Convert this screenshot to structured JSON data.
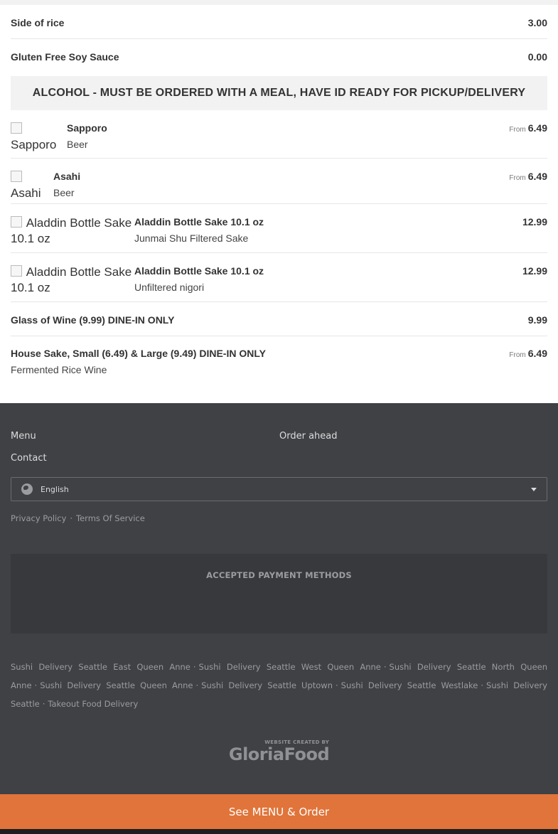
{
  "menu_items_top": [
    {
      "name": "Side of rice",
      "price": "3.00"
    },
    {
      "name": "Gluten Free Soy Sauce",
      "price": "0.00"
    }
  ],
  "category": {
    "title": "ALCOHOL - MUST BE ORDERED WITH A MEAL, HAVE ID READY FOR PICKUP/DELIVERY"
  },
  "items": [
    {
      "img_alt": "Sapporo",
      "name": "Sapporo",
      "desc": "Beer",
      "from": "From",
      "price": "6.49"
    },
    {
      "img_alt": "Asahi",
      "name": "Asahi",
      "desc": "Beer",
      "from": "From",
      "price": "6.49"
    },
    {
      "img_alt_1": "Aladdin Bottle Sake",
      "img_alt_2": "10.1 oz",
      "name": "Aladdin Bottle Sake 10.1 oz",
      "desc": "Junmai Shu Filtered Sake",
      "price": "12.99"
    },
    {
      "img_alt_1": "Aladdin Bottle Sake",
      "img_alt_2": "10.1 oz",
      "name": "Aladdin Bottle Sake 10.1 oz",
      "desc": "Unfiltered nigori",
      "price": "12.99"
    }
  ],
  "wine": {
    "name": "Glass of Wine (9.99) DINE-IN ONLY",
    "price": "9.99"
  },
  "house_sake": {
    "name": "House Sake, Small (6.49) & Large (9.49) DINE-IN ONLY",
    "desc": "Fermented Rice Wine",
    "from": "From",
    "price": "6.49"
  },
  "footer": {
    "links": {
      "menu": "Menu",
      "order_ahead": "Order ahead",
      "contact": "Contact"
    },
    "language": "English",
    "legal": {
      "privacy": "Privacy Policy",
      "terms": "Terms Of Service",
      "sep": "·"
    },
    "payment_title": "ACCEPTED PAYMENT METHODS",
    "delivery_links": [
      "Sushi Delivery Seattle East Queen Anne",
      "Sushi Delivery Seattle West Queen Anne",
      "Sushi Delivery Seattle North Queen Anne",
      "Sushi Delivery Seattle Queen Anne",
      "Sushi Delivery Seattle Uptown",
      "Sushi Delivery Seattle Westlake",
      "Sushi Delivery Seattle",
      "Takeout Food Delivery"
    ],
    "brand_small": "WEBSITE CREATED BY",
    "brand": "GloriaFood"
  },
  "order_button": "See MENU & Order",
  "colors": {
    "accent": "#e0743a",
    "footer_bg": "#3f4145",
    "category_bg": "#f2f2f2"
  }
}
